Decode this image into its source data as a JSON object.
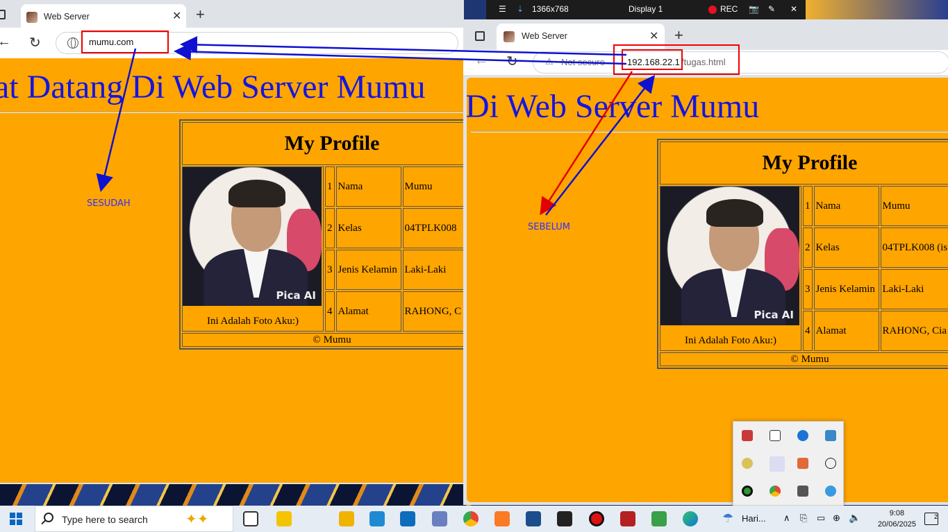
{
  "left_browser": {
    "tab_title": "Web Server",
    "url": "mumu.com",
    "welcome": "at Datang Di Web Server Mumu",
    "annotation": "SESUDAH"
  },
  "right_browser": {
    "tab_title": "Web Server",
    "not_secure": "Not secure",
    "url_host": "192.168.22.1",
    "url_path": "/tugas.html",
    "welcome": "Di Web Server Mumu",
    "annotation": "SEBELUM"
  },
  "profile": {
    "title": "My Profile",
    "caption": "Ini Adalah Foto Aku:)",
    "footer": "© Mumu",
    "watermark": "Pica AI",
    "rows": [
      {
        "no": "1",
        "field": "Nama",
        "value": "Mumu"
      },
      {
        "no": "2",
        "field": "Kelas",
        "value": "04TPLK008 (is"
      },
      {
        "no": "3",
        "field": "Jenis Kelamin",
        "value": "Laki-Laki"
      },
      {
        "no": "4",
        "field": "Alamat",
        "value": "RAHONG, Cia"
      }
    ],
    "rows_left_values": [
      "Mumu",
      "04TPLK008",
      "Laki-Laki",
      "RAHONG, C"
    ]
  },
  "recorder": {
    "resolution": "1366x768",
    "display": "Display 1",
    "rec": "REC"
  },
  "taskbar": {
    "search_placeholder": "Type here to search",
    "weather": "Hari...",
    "time": "9:08",
    "date": "20/06/2025",
    "notifications": "2"
  },
  "colors": {
    "page_bg": "#ffa500",
    "heading_blue": "#1515e0",
    "highlight_red": "#e00000",
    "arrow_blue": "#1010d0"
  }
}
